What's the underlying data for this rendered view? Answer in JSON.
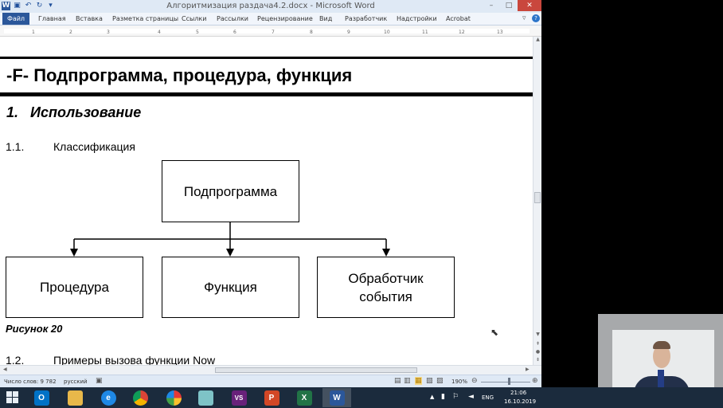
{
  "window": {
    "title": "Алгоритмизация раздача4.2.docx - Microsoft Word",
    "file_tab": "Файл",
    "tabs": [
      "Главная",
      "Вставка",
      "Разметка страницы",
      "Ссылки",
      "Рассылки",
      "Рецензирование",
      "Вид",
      "Разработчик",
      "Надстройки",
      "Acrobat"
    ],
    "ruler_ticks": [
      "1",
      "2",
      "3",
      "4",
      "5",
      "6",
      "7",
      "8",
      "9",
      "10",
      "11",
      "12",
      "13"
    ],
    "buttons": {
      "minimize": "–",
      "maximize": "□",
      "close": "✕"
    }
  },
  "document": {
    "heading": "-F- Подпрограмма, процедура, функция",
    "section1": {
      "number": "1.",
      "title": "Использование"
    },
    "section1_1": {
      "number": "1.1.",
      "title": "Классификация"
    },
    "diagram": {
      "root": "Подпрограмма",
      "children": [
        "Процедура",
        "Функция",
        "Обработчик события"
      ]
    },
    "caption": "Рисунок 20",
    "section1_2": {
      "number": "1.2.",
      "title": "Примеры вызова функции Now"
    }
  },
  "statusbar": {
    "words": "Число слов: 9 782",
    "language": "русский",
    "zoom": "190%"
  },
  "taskbar": {
    "apps": [
      "outlook-app",
      "explorer-app",
      "ie-app",
      "chrome-app",
      "picasa-app",
      "notepad-app",
      "visual-studio-app",
      "powerpoint-app",
      "excel-app",
      "word-app"
    ],
    "app_letters": {
      "outlook": "O",
      "visual_studio": "VS",
      "powerpoint": "P",
      "excel": "X",
      "word": "W"
    },
    "language": "ENG",
    "time": "21:06",
    "date": "16.10.2019",
    "colors": {
      "word": "#2b579a",
      "excel": "#217346",
      "powerpoint": "#d24726",
      "outlook": "#0072c6",
      "vs": "#68217a"
    }
  }
}
